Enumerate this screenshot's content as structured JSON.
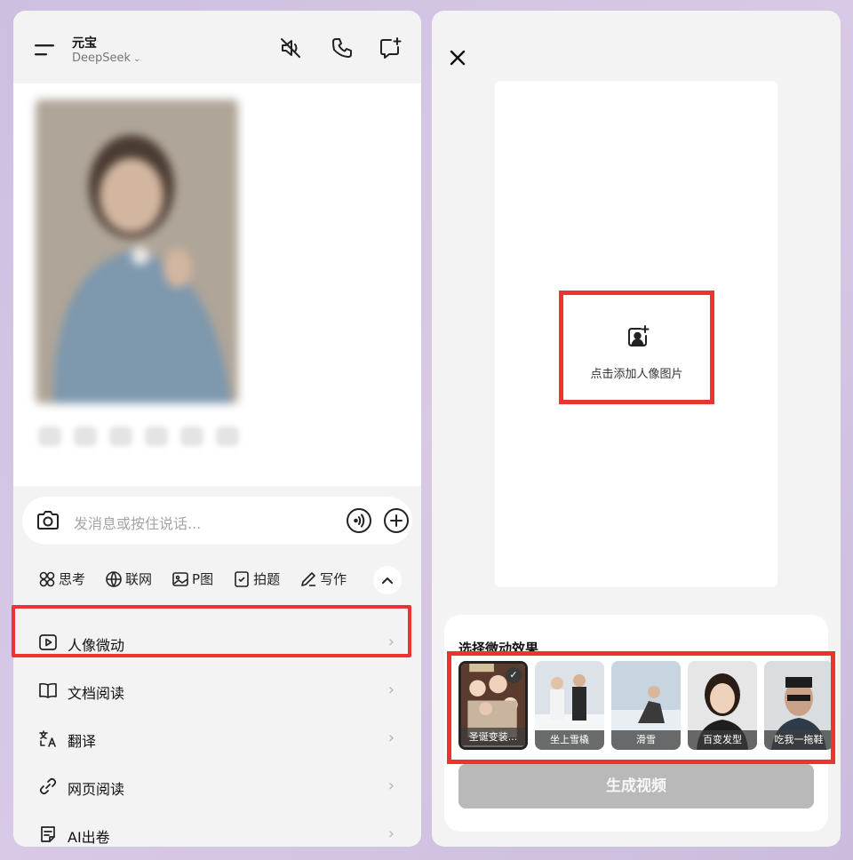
{
  "left": {
    "app_title": "元宝",
    "model_name": "DeepSeek",
    "chat_placeholder": "发消息或按住说话...",
    "tools": [
      {
        "label": "思考",
        "icon": "think-icon"
      },
      {
        "label": "联网",
        "icon": "globe-icon"
      },
      {
        "label": "P图",
        "icon": "image-edit-icon"
      },
      {
        "label": "拍题",
        "icon": "question-scan-icon"
      },
      {
        "label": "写作",
        "icon": "pen-icon"
      }
    ],
    "menu": [
      {
        "label": "人像微动",
        "icon": "play-square-icon"
      },
      {
        "label": "文档阅读",
        "icon": "book-icon"
      },
      {
        "label": "翻译",
        "icon": "translate-icon"
      },
      {
        "label": "网页阅读",
        "icon": "link-icon"
      },
      {
        "label": "AI出卷",
        "icon": "exam-icon"
      }
    ],
    "menu_arrow": "›"
  },
  "right": {
    "close_symbol": "✕",
    "upload_label": "点击添加人像图片",
    "effect_title": "选择微动效果",
    "effects": [
      {
        "label": "圣诞变装...",
        "selected": true
      },
      {
        "label": "坐上雪橇",
        "selected": false
      },
      {
        "label": "滑雪",
        "selected": false
      },
      {
        "label": "百变发型",
        "selected": false
      },
      {
        "label": "吃我一拖鞋",
        "selected": false
      }
    ],
    "check_symbol": "✓",
    "generate_button": "生成视频"
  },
  "colors": {
    "highlight": "#ea3434",
    "panel_bg": "#f3f3f3",
    "generate_disabled": "#b9b9b9"
  }
}
